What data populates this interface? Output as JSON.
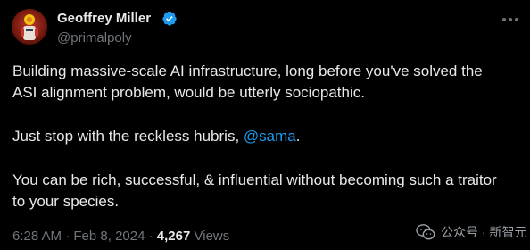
{
  "author": {
    "display_name": "Geoffrey Miller",
    "handle": "@primalpoly",
    "avatar_icon": "avatar-image",
    "verified_icon": "verified-badge-icon",
    "verified_color": "#1d9bf0"
  },
  "menu": {
    "icon": "more-options-icon"
  },
  "tweet": {
    "paragraph1_line1": "Building massive-scale AI infrastructure, long before you've solved the",
    "paragraph1_line2": "ASI alignment problem, would be utterly sociopathic.",
    "paragraph2_prefix": "Just stop with the reckless hubris, ",
    "mention": "@sama",
    "paragraph2_suffix": ".",
    "paragraph3_line1": "You can be rich, successful, & influential without becoming such a traitor",
    "paragraph3_line2": "to your species."
  },
  "meta": {
    "time": "6:28 AM",
    "separator": " · ",
    "date": "Feb 8, 2024",
    "separator2": " · ",
    "views_count": "4,267",
    "views_label": " Views"
  },
  "watermark": {
    "icon": "wechat-icon",
    "text": "公众号 · 新智元"
  },
  "colors": {
    "background": "#000000",
    "text": "#e7e9ea",
    "secondary": "#71767b",
    "link": "#1d9bf0"
  }
}
